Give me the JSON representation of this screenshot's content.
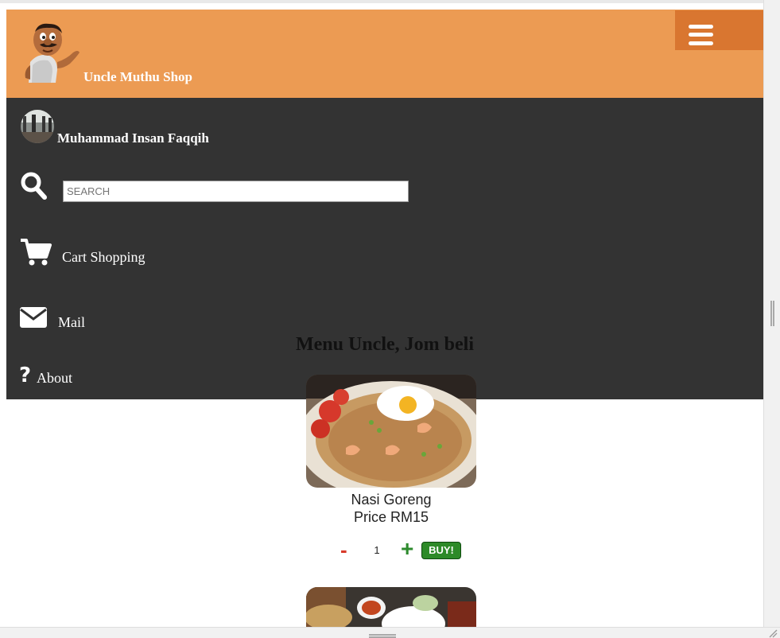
{
  "header": {
    "shop_name": "Uncle Muthu Shop",
    "logo_icon": "uncle-cartoon-logo",
    "menu_icon": "hamburger-icon",
    "bg_color": "#ec9b53",
    "menu_bg_color": "#d97630"
  },
  "nav": {
    "bg_color": "#333333",
    "username": "Muhammad Insan Faqqih",
    "search": {
      "placeholder": "SEARCH",
      "value": ""
    },
    "items": [
      {
        "label": "Cart Shopping",
        "icon": "shopping-cart-icon"
      },
      {
        "label": "Mail",
        "icon": "envelope-icon"
      },
      {
        "label": "About",
        "icon": "question-mark-icon"
      }
    ]
  },
  "main": {
    "section_title": "Menu Uncle, Jom beli",
    "products": [
      {
        "name": "Nasi Goreng",
        "price": "Price RM15",
        "quantity": "1",
        "minus_label": "-",
        "plus_label": "+",
        "buy_label": "BUY!",
        "accent_buy": "#2d8a28",
        "accent_minus": "#d83a2a"
      }
    ]
  }
}
